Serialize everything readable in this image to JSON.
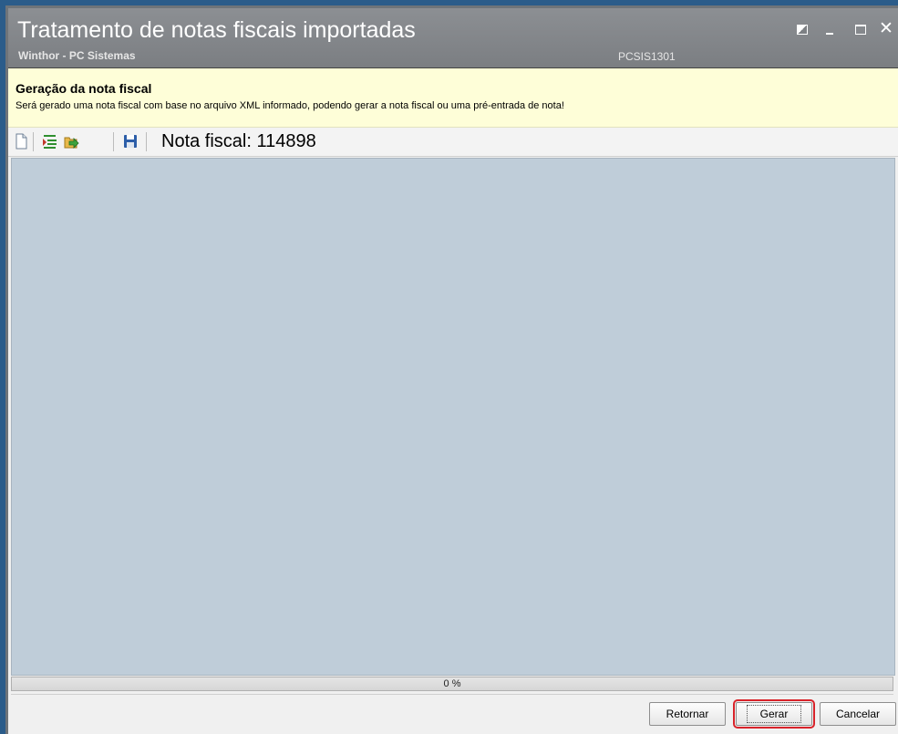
{
  "window": {
    "title": "Tratamento de notas fiscais importadas",
    "subtitle": "Winthor - PC Sistemas",
    "code": "PCSIS1301"
  },
  "info": {
    "heading": "Geração da nota fiscal",
    "text": "Será gerado uma nota fiscal com base no arquivo XML informado, podendo gerar a nota fiscal ou uma pré-entrada de nota!"
  },
  "toolbar": {
    "nota_label": "Nota fiscal: 114898",
    "icons": [
      "new-document-icon",
      "import-icon",
      "export-icon",
      "save-icon"
    ]
  },
  "progress": {
    "value": 0,
    "label": "0 %"
  },
  "buttons": {
    "retornar": "Retornar",
    "gerar": "Gerar",
    "cancelar": "Cancelar"
  },
  "colors": {
    "titlebar": "#808387",
    "infobar": "#fefed8",
    "content": "#bfcdd9",
    "highlight": "#d8232a"
  }
}
